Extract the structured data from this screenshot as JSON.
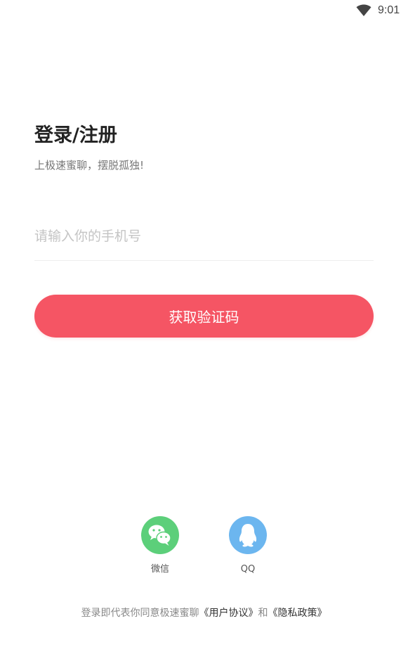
{
  "status_bar": {
    "time": "9:01",
    "wifi_icon": "wifi-icon"
  },
  "header": {
    "title": "登录/注册",
    "subtitle": "上极速蜜聊，摆脱孤独!"
  },
  "form": {
    "phone_placeholder": "请输入你的手机号",
    "phone_value": "",
    "submit_label": "获取验证码"
  },
  "social_login": {
    "items": [
      {
        "label": "微信",
        "icon": "wechat-icon",
        "color": "#5ccf7a"
      },
      {
        "label": "QQ",
        "icon": "qq-penguin-icon",
        "color": "#6cb6ef"
      }
    ]
  },
  "agreement": {
    "prefix": "登录即代表你同意极速蜜聊",
    "user_agreement": "《用户协议》",
    "connector": "和",
    "privacy_policy": "《隐私政策》"
  },
  "colors": {
    "accent": "#f55564",
    "placeholder": "#c4c4c4"
  }
}
